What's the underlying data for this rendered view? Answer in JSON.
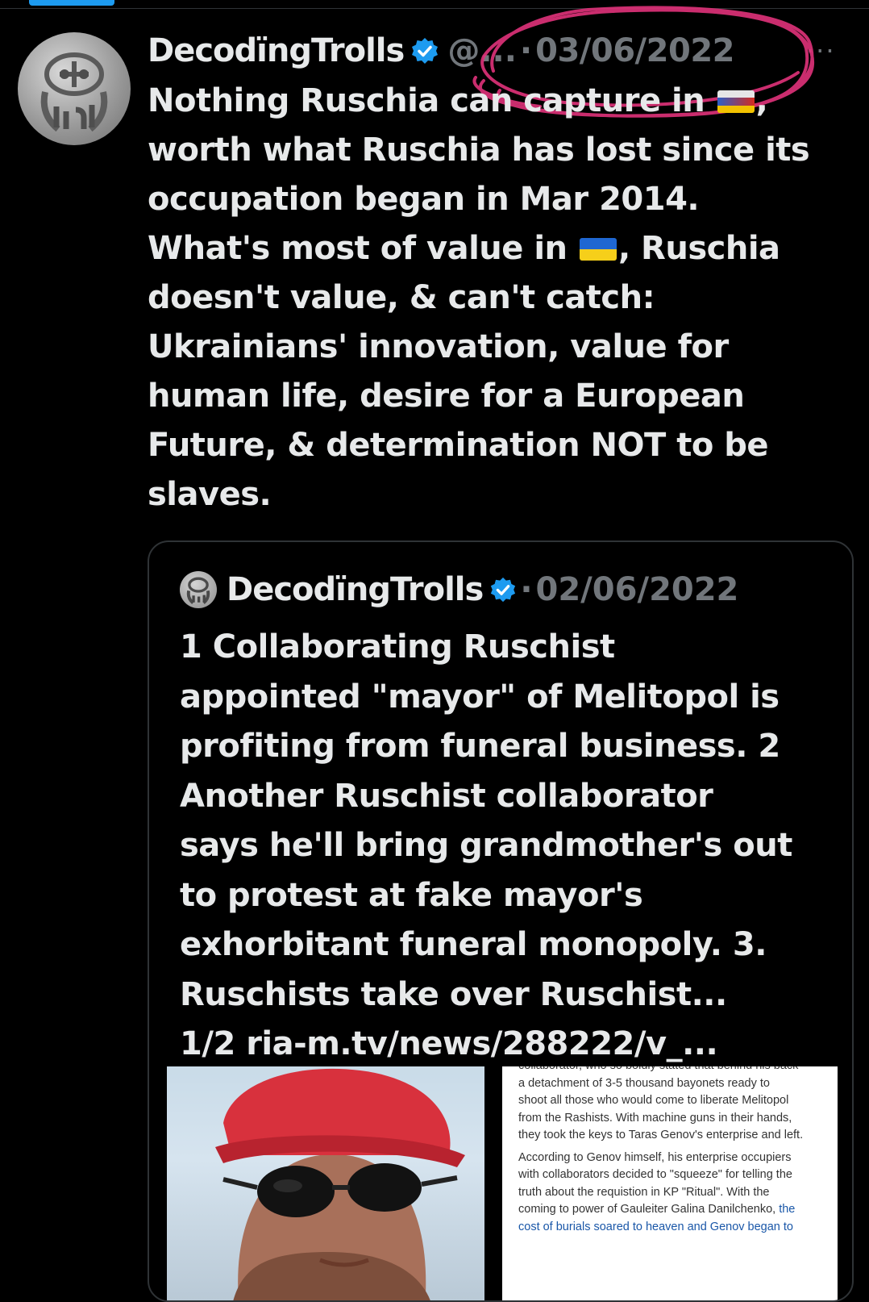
{
  "tweet": {
    "author_name": "DecodïngTrolls",
    "handle": "@...",
    "date": "03/06/2022",
    "more": "···",
    "text_lines": [
      [
        "Nothing Ruschia can capture in ",
        "flag:ua-ru",
        ","
      ],
      [
        "worth what Ruschia has lost since its"
      ],
      [
        "occupation began in Mar 2014."
      ],
      [
        "What's most of value in ",
        "flag:ua",
        ", Ruschia"
      ],
      [
        "doesn't value, & can't catch:"
      ],
      [
        "Ukrainians' innovation, value for"
      ],
      [
        "human life, desire for a European"
      ],
      [
        "Future, & determination NOT to be"
      ],
      [
        "slaves."
      ]
    ]
  },
  "quoted_tweet": {
    "author_name": "DecodïngTrolls",
    "date": "02/06/2022",
    "text_lines": [
      "1 Collaborating Ruschist",
      "appointed \"mayor\" of Melitopol is",
      "profiting from funeral business. 2",
      "Another Ruschist collaborator",
      "says he'll bring grandmother's out",
      "to protest at fake mayor's",
      "exhorbitant funeral monopoly. 3.",
      "Ruschists take over Ruschist...",
      "1/2 ria-m.tv/news/288222/v_..."
    ],
    "article_lines": [
      "collaborator, who so boldly stated that behind his back",
      "a detachment of 3-5 thousand bayonets ready to",
      "shoot all those who would come to liberate Melitopol",
      "from the Rashists. With machine guns in their hands,",
      "they took the keys to Taras Genov's enterprise and left."
    ],
    "article_para2": [
      "According to Genov himself, his enterprise occupiers",
      "with collaborators decided to \"squeeze\" for telling the",
      "truth about the requistion in KP \"Ritual\". With the"
    ],
    "article_mixed_line": "coming to power of Gauleiter Galina Danilchenko, ",
    "article_mixed_link": "the",
    "article_link_line": "cost of burials soared to heaven and Genov began to"
  },
  "colors": {
    "background": "#000000",
    "text": "#e7e9ea",
    "muted": "#71767b",
    "verified": "#1d9bf0",
    "scribble": "#e0327a",
    "border": "#2f3336"
  }
}
